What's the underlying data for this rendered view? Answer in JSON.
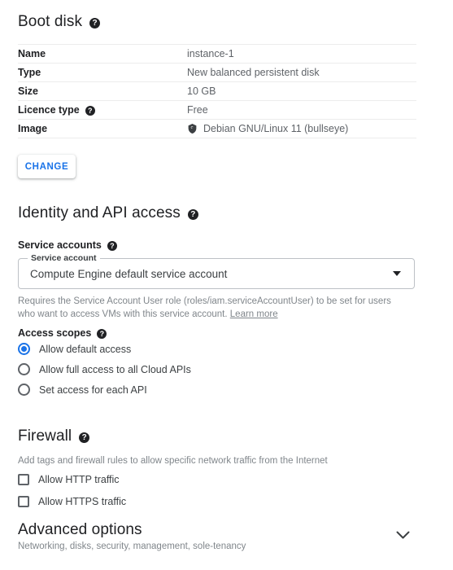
{
  "boot_disk": {
    "title": "Boot disk",
    "help_glyph": "?",
    "rows": [
      {
        "key": "Name",
        "value": "instance-1",
        "has_help": false,
        "has_image_icon": false
      },
      {
        "key": "Type",
        "value": "New balanced persistent disk",
        "has_help": false,
        "has_image_icon": false
      },
      {
        "key": "Size",
        "value": "10 GB",
        "has_help": false,
        "has_image_icon": false
      },
      {
        "key": "Licence type",
        "value": "Free",
        "has_help": true,
        "has_image_icon": false
      },
      {
        "key": "Image",
        "value": "Debian GNU/Linux 11 (bullseye)",
        "has_help": false,
        "has_image_icon": true
      }
    ],
    "change_label": "CHANGE"
  },
  "identity": {
    "title": "Identity and API access",
    "service_accounts_label": "Service accounts",
    "select": {
      "float_label": "Service account",
      "value": "Compute Engine default service account",
      "caret_icon": "chevron-down-icon"
    },
    "helper_text": "Requires the Service Account User role (roles/iam.serviceAccountUser) to be set for users who want to access VMs with this service account. ",
    "helper_link": "Learn more"
  },
  "access_scopes": {
    "label": "Access scopes",
    "options": [
      {
        "label": "Allow default access",
        "selected": true
      },
      {
        "label": "Allow full access to all Cloud APIs",
        "selected": false
      },
      {
        "label": "Set access for each API",
        "selected": false
      }
    ]
  },
  "firewall": {
    "title": "Firewall",
    "description": "Add tags and firewall rules to allow specific network traffic from the Internet",
    "checkboxes": [
      {
        "label": "Allow HTTP traffic",
        "checked": false
      },
      {
        "label": "Allow HTTPS traffic",
        "checked": false
      }
    ]
  },
  "advanced": {
    "title": "Advanced options",
    "subtitle": "Networking, disks, security, management, sole-tenancy",
    "chevron_icon": "chevron-down-icon"
  },
  "colors": {
    "accent_blue": "#1a73e8",
    "text_primary": "#202124",
    "text_secondary": "#5f6368",
    "text_muted": "#80868b",
    "divider": "#ececec",
    "field_border": "#bdc1c6"
  }
}
